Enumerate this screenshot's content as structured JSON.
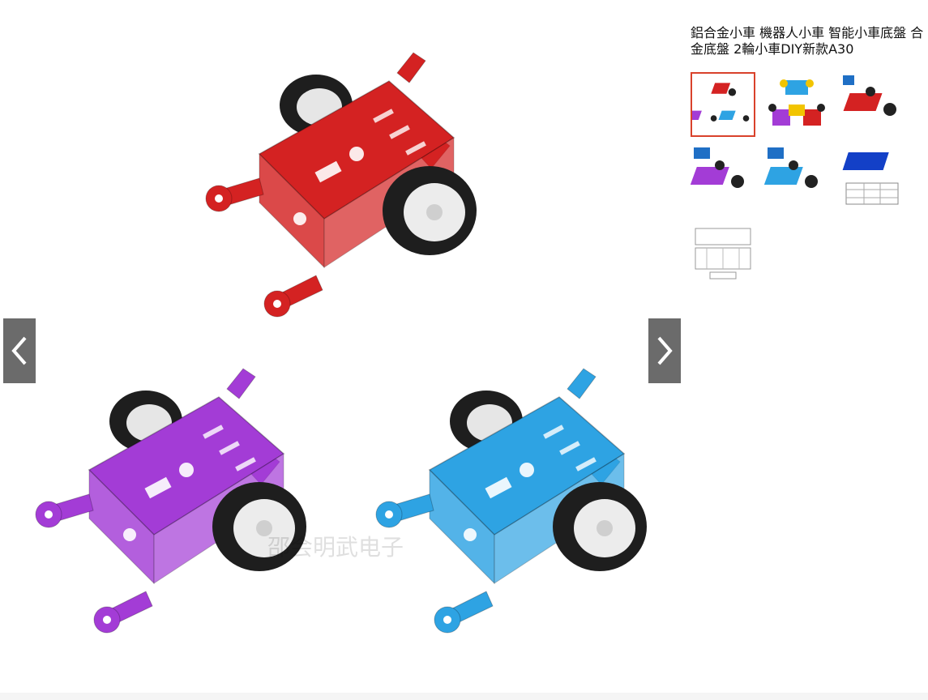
{
  "viewer": {
    "watermark": "邵会明武电子",
    "prev_icon": "chevron-left-icon",
    "next_icon": "chevron-right-icon",
    "nav_color": "#6b6b6b"
  },
  "product": {
    "title": "鋁合金小車 機器人小車 智能小車底盤 合金底盤 2輪小車DIY新款A30"
  },
  "gallery": {
    "active_index": 0,
    "active_border_color": "#d9422b",
    "thumbnails": [
      {
        "name": "three-color-chassis"
      },
      {
        "name": "four-chassis-assortment"
      },
      {
        "name": "red-chassis-logo"
      },
      {
        "name": "purple-chassis-logo"
      },
      {
        "name": "blue-chassis-logo"
      },
      {
        "name": "dark-blue-chassis-drawing"
      },
      {
        "name": "technical-drawing"
      }
    ]
  },
  "colors": {
    "red": "#d42222",
    "purple": "#a33cd6",
    "blue": "#2ea3e3",
    "tire": "#222222",
    "hub": "#eeeeee"
  }
}
